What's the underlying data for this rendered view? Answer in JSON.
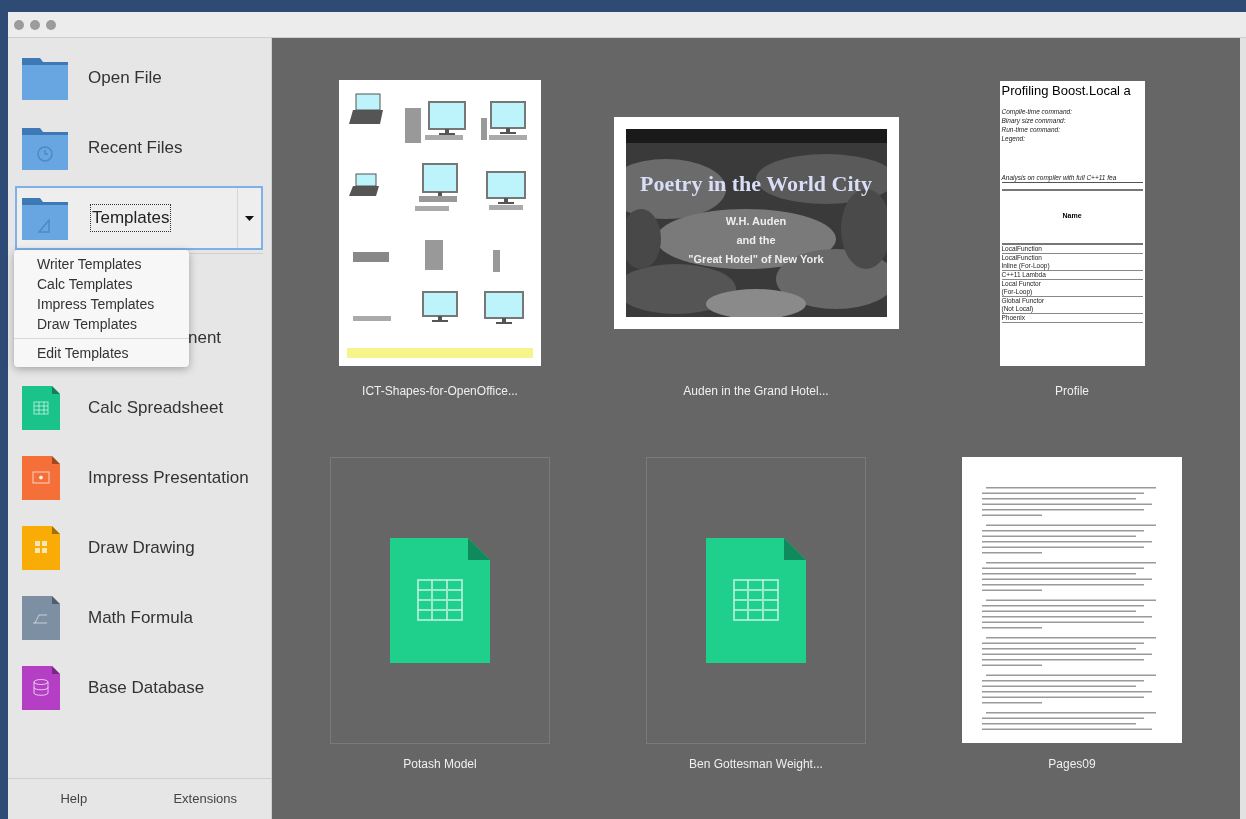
{
  "sidebar": {
    "items": [
      {
        "kind": "folder",
        "label": "Open File",
        "selected": false
      },
      {
        "kind": "recent",
        "label": "Recent Files",
        "selected": false
      },
      {
        "kind": "templates",
        "label": "Templates",
        "selected": true
      },
      {
        "kind": "covered",
        "label": "nent",
        "selected": false
      },
      {
        "kind": "calc",
        "label": "Calc Spreadsheet",
        "selected": false
      },
      {
        "kind": "impress",
        "label": "Impress Presentation",
        "selected": false
      },
      {
        "kind": "draw",
        "label": "Draw Drawing",
        "selected": false
      },
      {
        "kind": "math",
        "label": "Math Formula",
        "selected": false
      },
      {
        "kind": "base",
        "label": "Base Database",
        "selected": false
      }
    ],
    "footer": [
      "Help",
      "Extensions"
    ]
  },
  "dropdown_menu": {
    "sections": [
      [
        "Writer Templates",
        "Calc Templates",
        "Impress Templates",
        "Draw Templates"
      ],
      [
        "Edit Templates"
      ]
    ]
  },
  "documents": [
    {
      "kind": "shapes",
      "title": "ICT-Shapes-for-OpenOffice..."
    },
    {
      "kind": "slide",
      "title": "Auden in the Grand Hotel...",
      "slide": {
        "heading": "Poetry in the World City",
        "lines": [
          "W.H. Auden",
          "and the",
          "\"Great Hotel\" of New York"
        ]
      }
    },
    {
      "kind": "table-doc",
      "title": "Profile",
      "doc": {
        "heading": "Profiling Boost.Local a",
        "lines": [
          "Compile-time command:",
          "Binary size command:",
          "Run-time command:",
          "Legend:"
        ],
        "caption": "Analysis on compiler with full C++11 fea",
        "column": "Name",
        "rows": [
          [
            "LocalFunction"
          ],
          [
            "LocalFunction",
            "Inline (For-Loop)"
          ],
          [
            "C++11 Lambda"
          ],
          [
            "Local Functor",
            "(For-Loop)"
          ],
          [
            "Global Functor",
            "(Not Local)"
          ],
          [
            "Phoenix"
          ]
        ]
      }
    },
    {
      "kind": "calc",
      "title": "Potash Model"
    },
    {
      "kind": "calc",
      "title": "Ben Gottesman Weight..."
    },
    {
      "kind": "text-doc",
      "title": "Pages09"
    }
  ]
}
